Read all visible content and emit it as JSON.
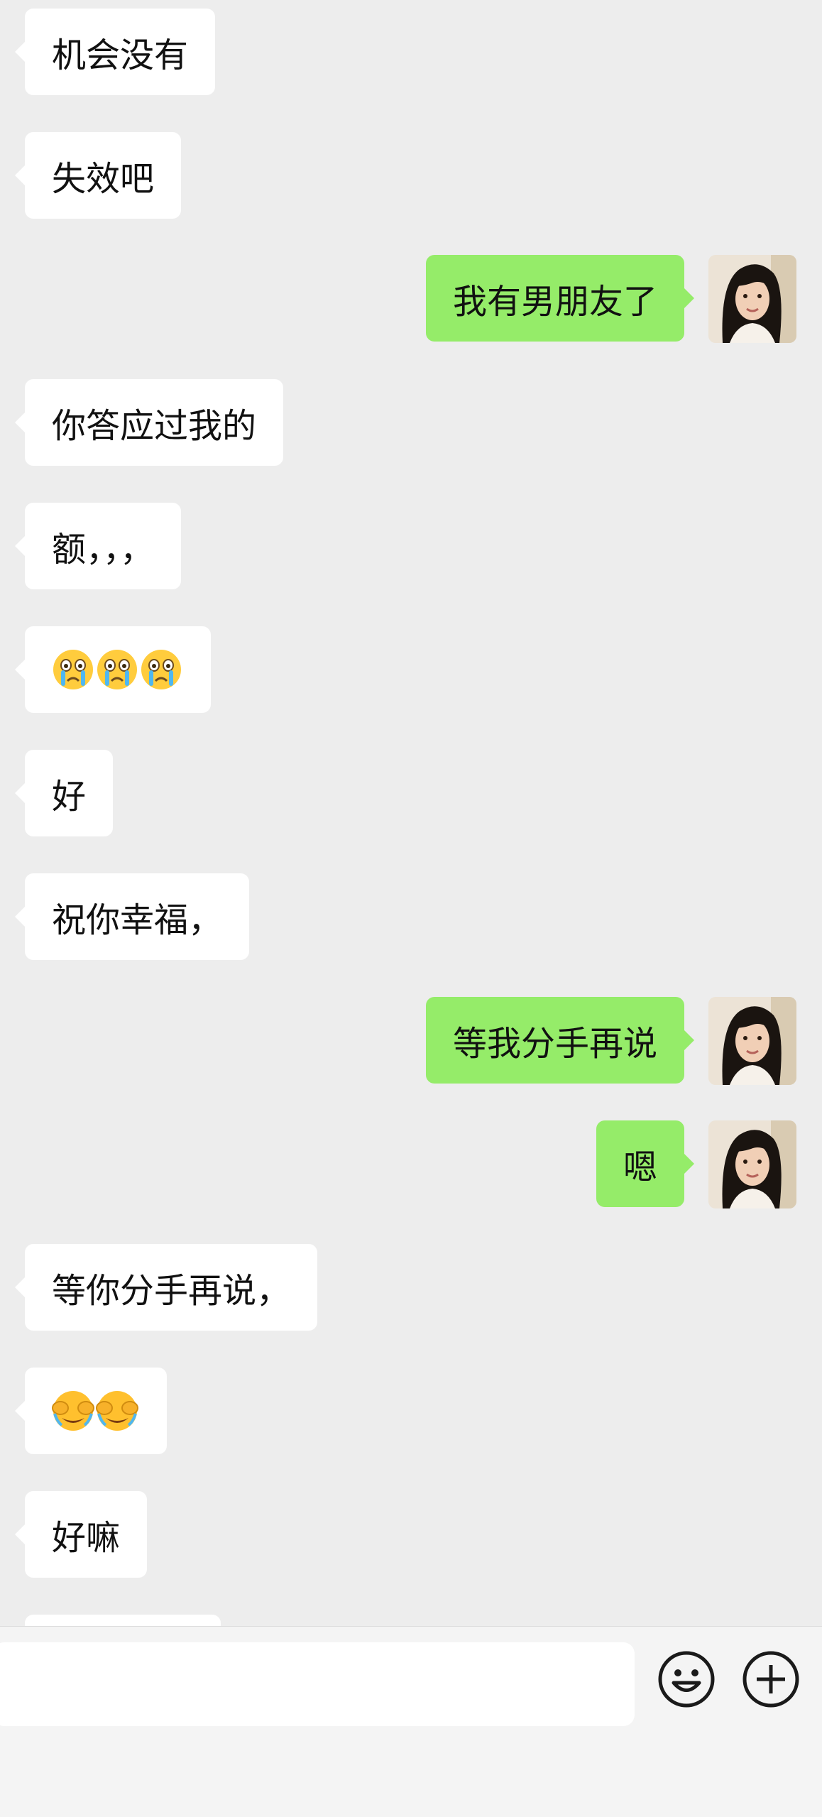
{
  "messages": [
    {
      "side": "in",
      "text": "机会没有"
    },
    {
      "side": "in",
      "text": "失效吧"
    },
    {
      "side": "out",
      "text": "我有男朋友了"
    },
    {
      "side": "in",
      "text": "你答应过我的"
    },
    {
      "side": "in",
      "text": "额，，，"
    },
    {
      "side": "in",
      "emoji": [
        "crying-face-icon",
        "crying-face-icon",
        "crying-face-icon"
      ]
    },
    {
      "side": "in",
      "text": "好"
    },
    {
      "side": "in",
      "text": "祝你幸福，"
    },
    {
      "side": "out",
      "text": "等我分手再说"
    },
    {
      "side": "out",
      "text": "嗯"
    },
    {
      "side": "in",
      "text": "等你分手再说，"
    },
    {
      "side": "in",
      "emoji": [
        "facepalm-cry-icon",
        "facepalm-cry-icon"
      ]
    },
    {
      "side": "in",
      "text": "好嘛"
    }
  ],
  "input_bar": {
    "icons": [
      "emoji-icon",
      "plus-icon"
    ]
  },
  "colors": {
    "background": "#ededed",
    "incoming_bubble": "#ffffff",
    "outgoing_bubble": "#95ec69",
    "text": "#111111"
  }
}
